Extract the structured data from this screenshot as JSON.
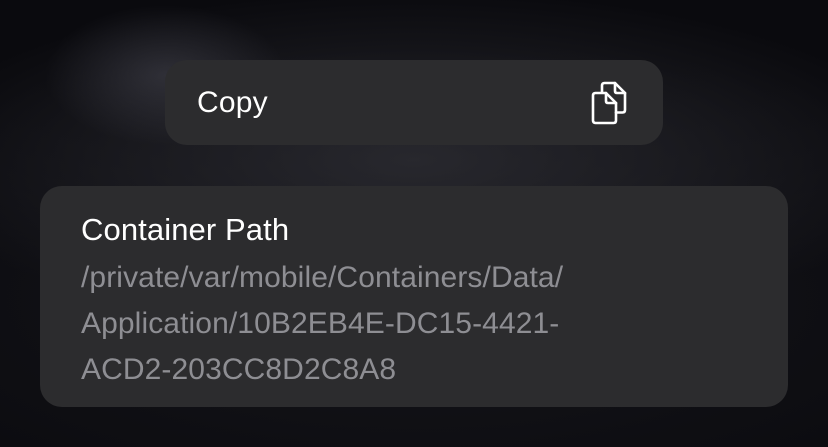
{
  "menu": {
    "copy_label": "Copy",
    "copy_icon": "copy-icon"
  },
  "detail": {
    "title": "Container Path",
    "value": "/private/var/mobile/Containers/Data/\nApplication/10B2EB4E-DC15-4421-\nACD2-203CC8D2C8A8"
  },
  "colors": {
    "background": "#0a0a0e",
    "surface": "#2c2c2e",
    "primary_text": "#ffffff",
    "secondary_text": "#8e8e93"
  }
}
